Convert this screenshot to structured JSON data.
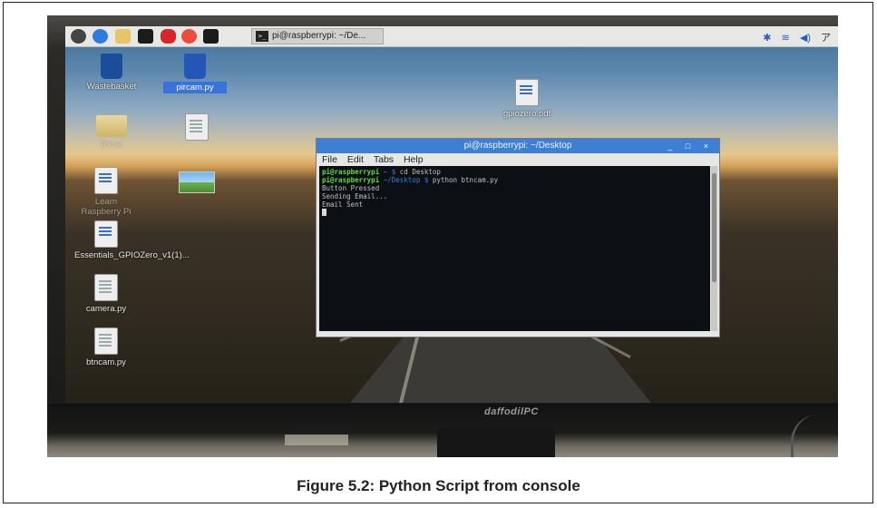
{
  "taskbar": {
    "window_title": "pi@raspberrypi: ~/De...",
    "window_icon_glyph": ">_",
    "launcher_icons": [
      "raspberry-menu-icon",
      "web-browser-icon",
      "file-manager-icon",
      "terminal-icon",
      "mathematica-icon",
      "wolfram-icon",
      "terminal-icon"
    ],
    "tray": {
      "bluetooth": "✱",
      "wifi": "≋",
      "volume": "◀)",
      "clock_partial": "ア"
    }
  },
  "desktop": {
    "icons": [
      {
        "label": "Wastebasket",
        "kind": "trash"
      },
      {
        "label": "pircam.py",
        "kind": "doc",
        "selected": true
      },
      {
        "label": "gpiozero.pdf",
        "kind": "doc-blue"
      },
      {
        "label": "Rene",
        "kind": "folder"
      },
      {
        "label": "",
        "kind": "doc"
      },
      {
        "label": "Learn Raspberry Pi",
        "kind": "doc-blue"
      },
      {
        "label": "",
        "kind": "image"
      },
      {
        "label": "Essentials_GPIOZero_v1(1)...",
        "kind": "doc-blue"
      },
      {
        "label": "camera.py",
        "kind": "doc"
      },
      {
        "label": "btncam.py",
        "kind": "doc"
      }
    ]
  },
  "terminal": {
    "title": "pi@raspberrypi: ~/Desktop",
    "controls": "_ □ ×",
    "menu": [
      "File",
      "Edit",
      "Tabs",
      "Help"
    ],
    "lines": [
      {
        "user": "pi@raspberrypi",
        "path": " ~ $ ",
        "cmd": "cd Desktop"
      },
      {
        "user": "pi@raspberrypi",
        "path": " ~/Desktop $ ",
        "cmd": "python btncam.py"
      },
      {
        "text": "Button Pressed"
      },
      {
        "text": "Sending Email..."
      },
      {
        "text": "Email Sent"
      }
    ]
  },
  "monitor": {
    "brand": "daffodilPC"
  },
  "caption": "Figure 5.2: Python Script from console"
}
